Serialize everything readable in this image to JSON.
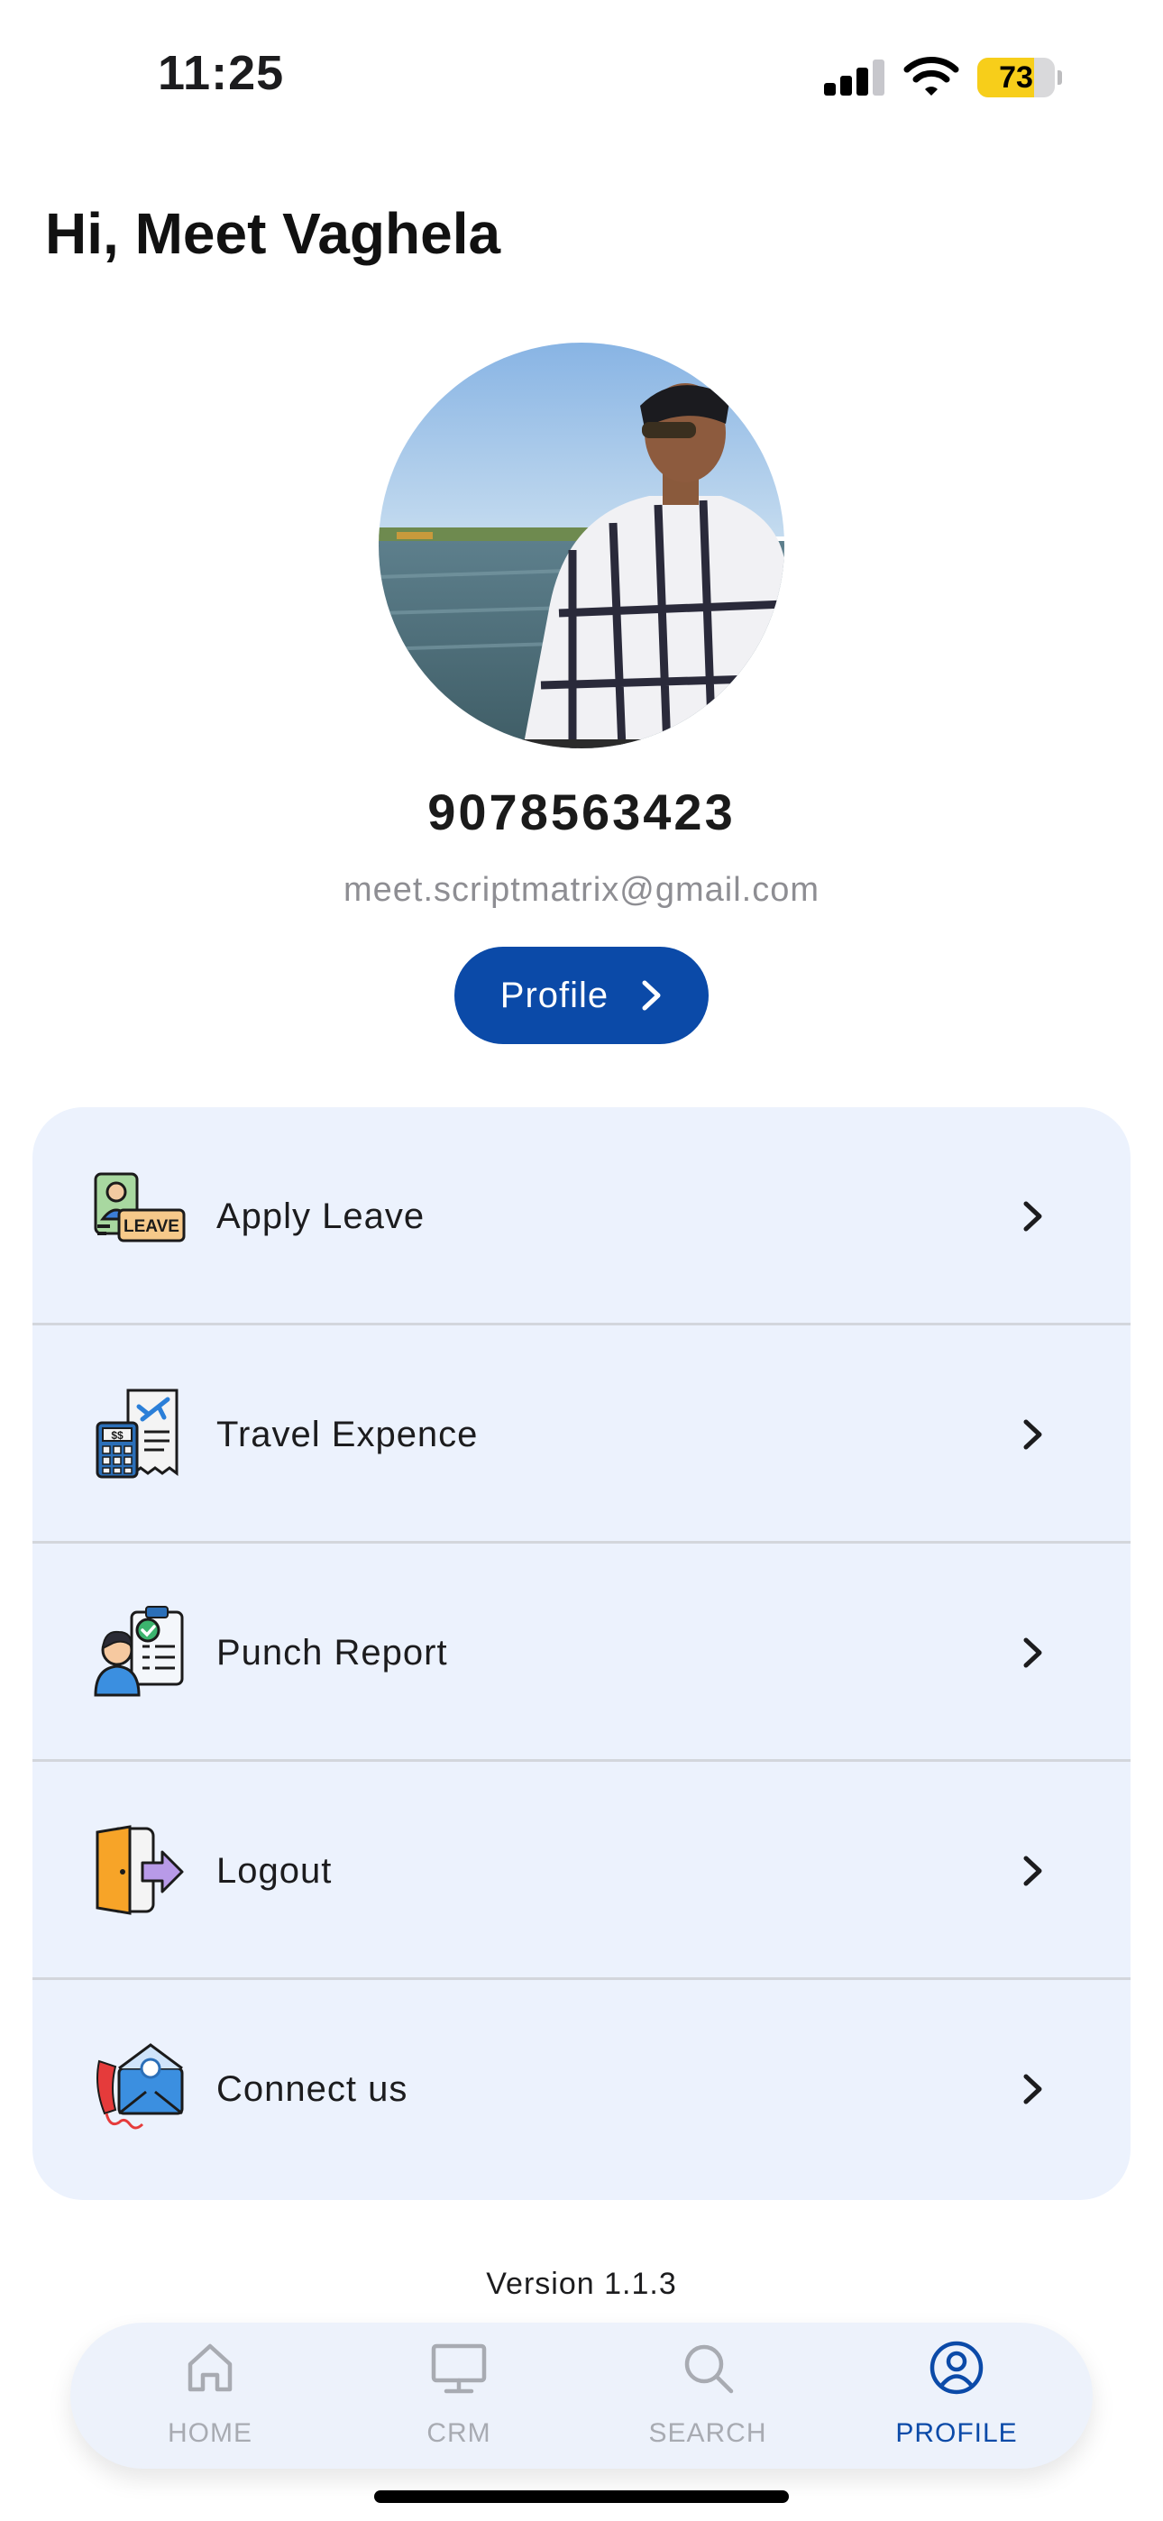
{
  "status_bar": {
    "time": "11:25",
    "battery": "73",
    "battery_level": 0.73,
    "battery_color": "#f7ce1a",
    "signal_icon": "cellular-signal-icon",
    "wifi_icon": "wifi-icon"
  },
  "greeting": "Hi, Meet Vaghela",
  "profile": {
    "phone": "9078563423",
    "email": "meet.scriptmatrix@gmail.com",
    "button_label": "Profile",
    "button_icon": "chevron-right-icon"
  },
  "menu": {
    "items": [
      {
        "label": "Apply Leave",
        "icon": "leave-icon",
        "icon_text": "LEAVE"
      },
      {
        "label": "Travel Expence",
        "icon": "travel-expense-icon"
      },
      {
        "label": "Punch Report",
        "icon": "punch-report-icon"
      },
      {
        "label": "Logout",
        "icon": "logout-door-icon"
      },
      {
        "label": "Connect us",
        "icon": "contact-mail-phone-icon"
      }
    ]
  },
  "version": "Version 1.1.3",
  "tab_bar": {
    "tabs": [
      {
        "label": "HOME",
        "icon": "home-icon",
        "active": false
      },
      {
        "label": "CRM",
        "icon": "monitor-icon",
        "active": false
      },
      {
        "label": "SEARCH",
        "icon": "search-icon",
        "active": false
      },
      {
        "label": "PROFILE",
        "icon": "user-circle-icon",
        "active": true
      }
    ]
  },
  "colors": {
    "accent": "#0b4aa8",
    "card_background": "#ecf2fd",
    "tab_inactive": "#a8abb2"
  }
}
